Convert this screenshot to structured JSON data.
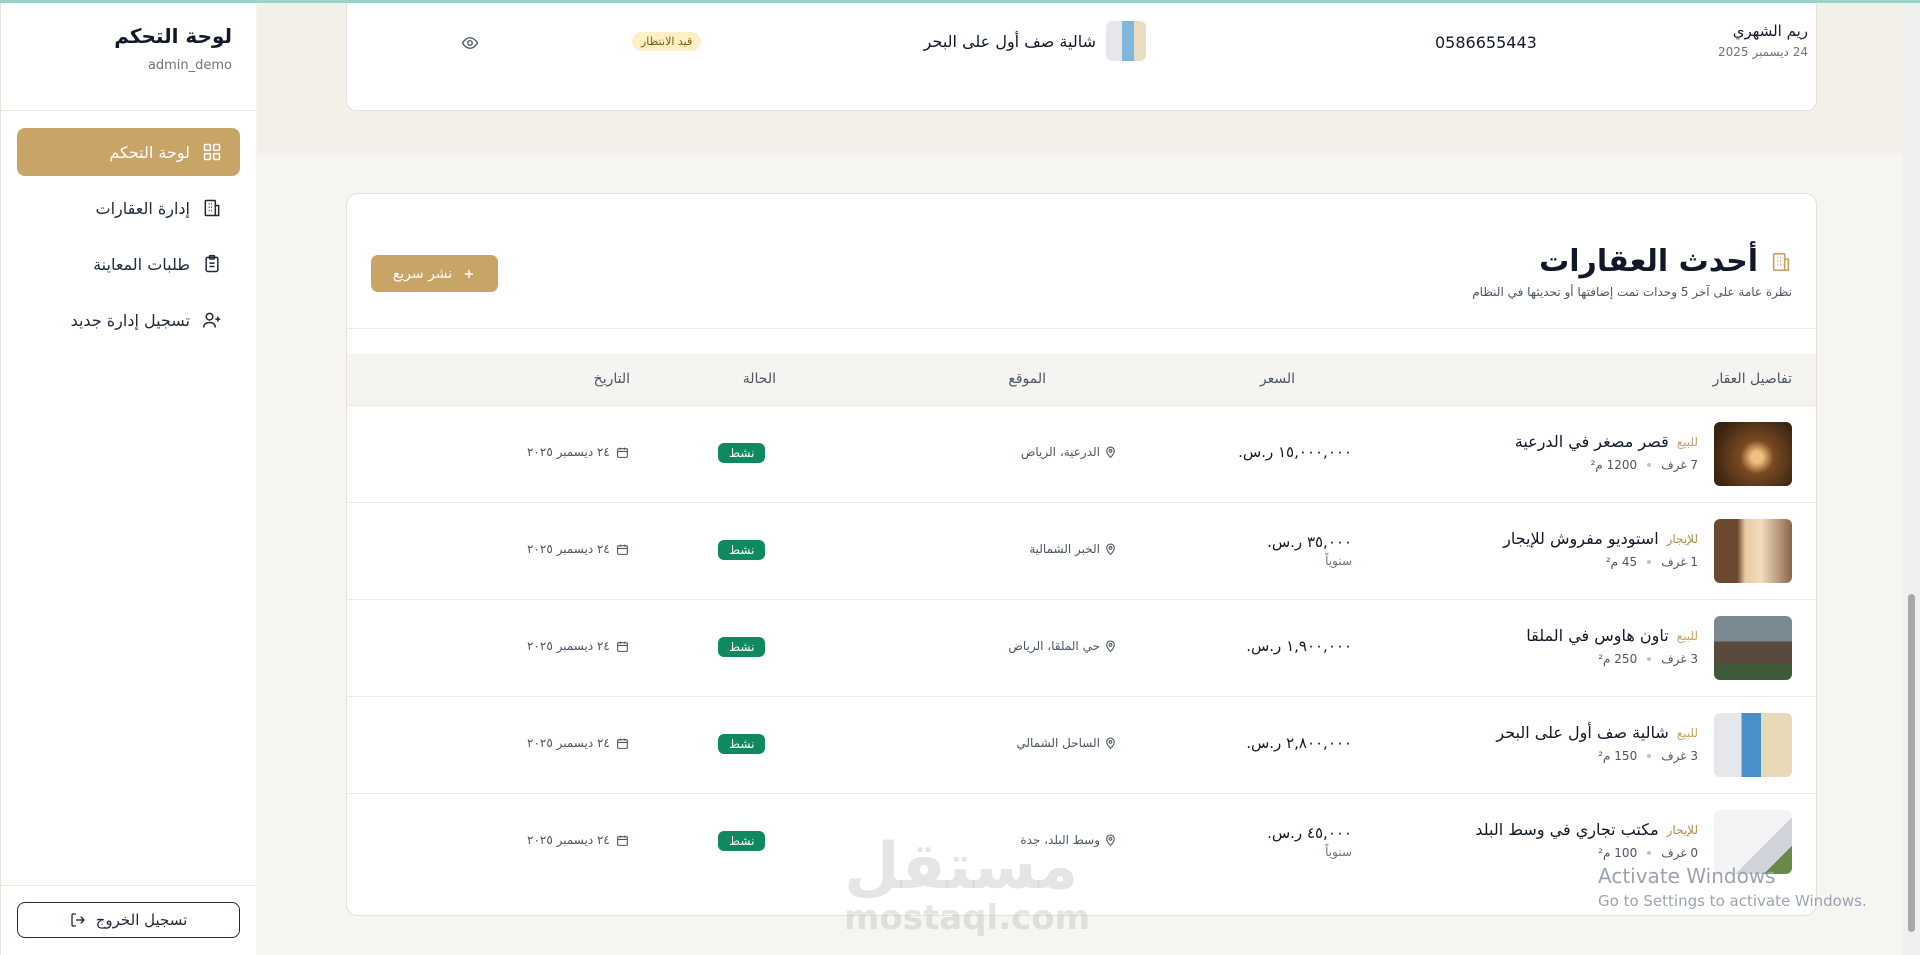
{
  "sidebar": {
    "title": "لوحة التحكم",
    "user": "admin_demo",
    "items": [
      {
        "label": "لوحة التحكم",
        "icon": "grid-icon",
        "active": true
      },
      {
        "label": "إدارة العقارات",
        "icon": "building-icon",
        "active": false
      },
      {
        "label": "طلبات المعاينة",
        "icon": "clipboard-icon",
        "active": false
      },
      {
        "label": "تسجيل إدارة جديد",
        "icon": "user-plus-icon",
        "active": false
      }
    ],
    "logout_label": "تسجيل الخروج"
  },
  "request_row": {
    "name": "ريم الشهري",
    "date": "24 ديسمبر 2025",
    "phone": "0586655443",
    "property": "شالية صف أول على البحر",
    "status": "قيد الانتظار"
  },
  "latest": {
    "title": "أحدث العقارات",
    "subtitle": "نظرة عامة على آخر 5 وحدات تمت إضافتها أو تحديثها في النظام",
    "quick_button": "نشر سريع",
    "columns": [
      "تفاصيل العقار",
      "السعر",
      "الموقع",
      "الحالة",
      "التاريخ"
    ],
    "rows": [
      {
        "type": "للبيع",
        "title": "قصر مصغر في الدرعية",
        "rooms": "7 غرف",
        "area": "1200 م²",
        "price": "١٥,٠٠٠,٠٠٠ ر.س.",
        "period": "",
        "location": "الدرعية، الرياض",
        "status": "نشط",
        "date": "٢٤ ديسمبر ٢٠٢٥"
      },
      {
        "type": "للإيجار",
        "title": "استوديو مفروش للإيجار",
        "rooms": "1 غرف",
        "area": "45 م²",
        "price": "٣٥,٠٠٠ ر.س.",
        "period": "سنوياً",
        "location": "الخبر الشمالية",
        "status": "نشط",
        "date": "٢٤ ديسمبر ٢٠٢٥"
      },
      {
        "type": "للبيع",
        "title": "تاون هاوس في الملقا",
        "rooms": "3 غرف",
        "area": "250 م²",
        "price": "١,٩٠٠,٠٠٠ ر.س.",
        "period": "",
        "location": "حي الملقا، الرياض",
        "status": "نشط",
        "date": "٢٤ ديسمبر ٢٠٢٥"
      },
      {
        "type": "للبيع",
        "title": "شالية صف أول على البحر",
        "rooms": "3 غرف",
        "area": "150 م²",
        "price": "٢,٨٠٠,٠٠٠ ر.س.",
        "period": "",
        "location": "الساحل الشمالي",
        "status": "نشط",
        "date": "٢٤ ديسمبر ٢٠٢٥"
      },
      {
        "type": "للإيجار",
        "title": "مكتب تجاري في وسط البلد",
        "rooms": "0 غرف",
        "area": "100 م²",
        "price": "٤٥,٠٠٠ ر.س.",
        "period": "سنوياً",
        "location": "وسط البلد، جدة",
        "status": "نشط",
        "date": "٢٤ ديسمبر ٢٠٢٥"
      }
    ]
  },
  "watermark": {
    "logo": "مستقل",
    "url": "mostaql.com"
  },
  "windows": {
    "line1": "Activate Windows",
    "line2": "Go to Settings to activate Windows."
  },
  "colors": {
    "accent": "#c9a467",
    "active_status": "#0f8a5f",
    "pending_bg": "#fdf0c8"
  }
}
